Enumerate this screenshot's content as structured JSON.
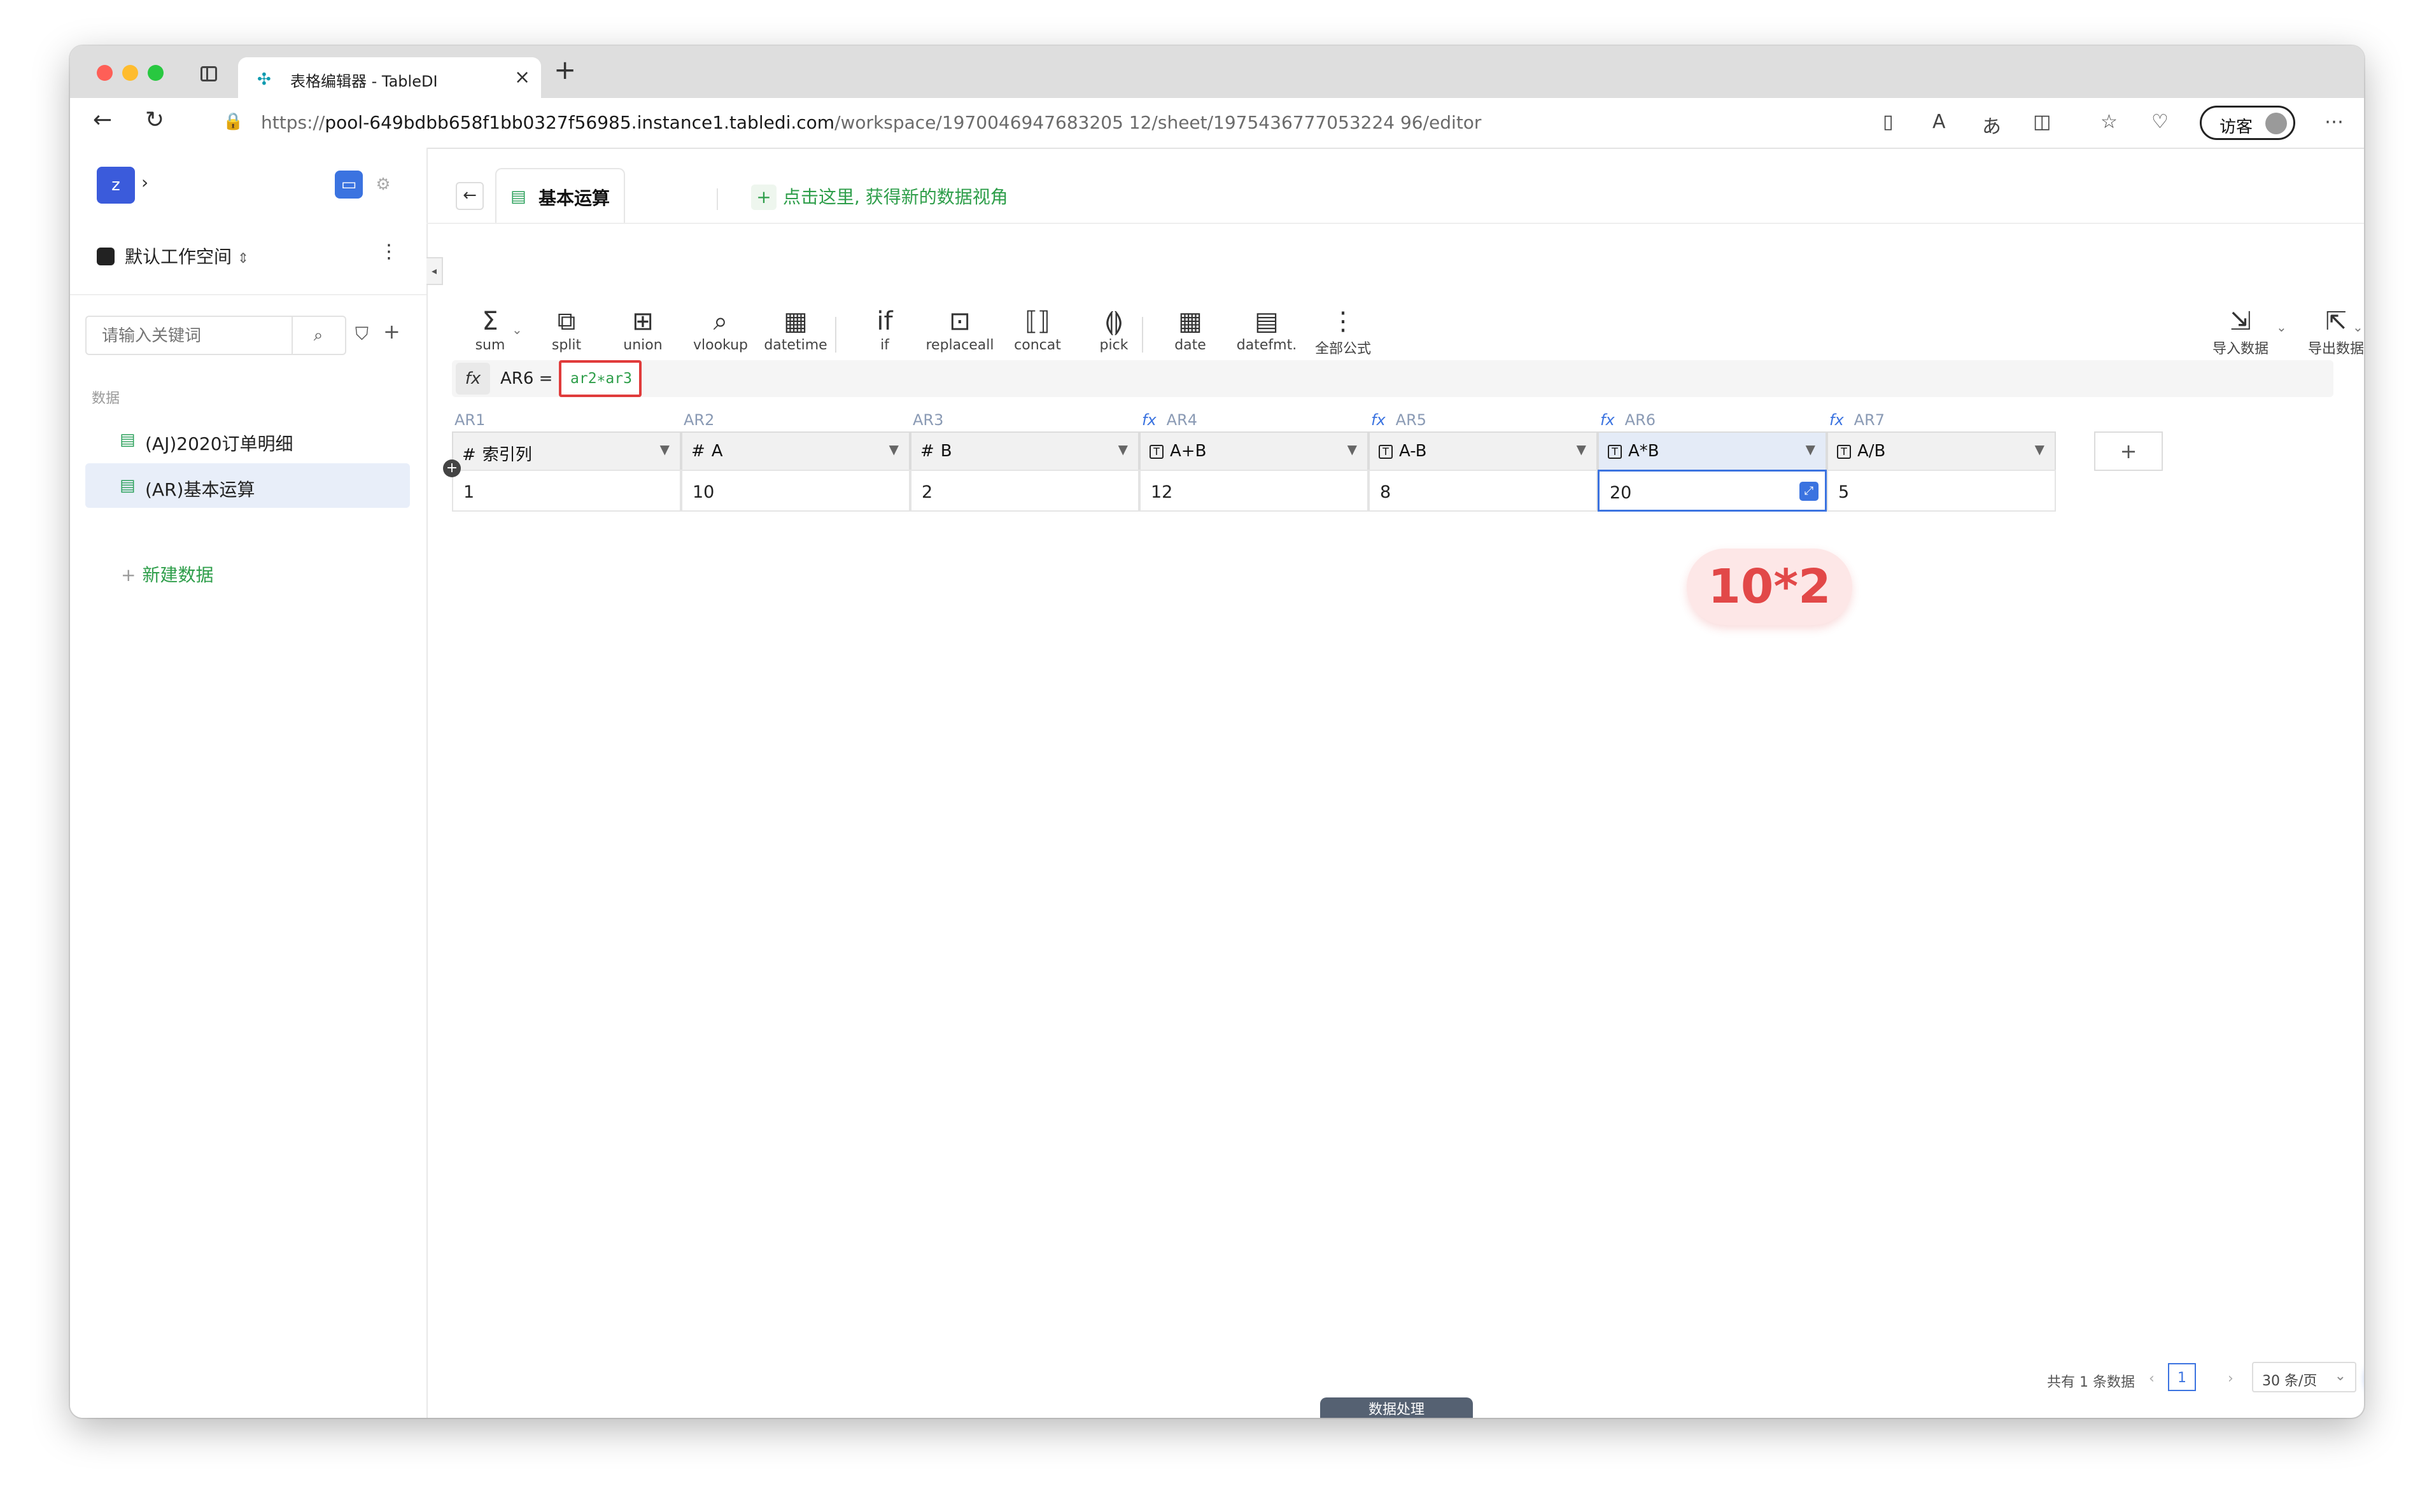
{
  "browser": {
    "tab_title": "表格编辑器 - TableDI",
    "url_prefix": "https://",
    "url_host": "pool-649bdbb658f1bb0327f56985.instance1.tabledi.com",
    "url_path": "/workspace/1970046947683205 12/sheet/1975436777053224 96/editor",
    "visitor_label": "访客"
  },
  "sidebar": {
    "avatar_letter": "z",
    "workspace_name": "默认工作空间",
    "search_placeholder": "请输入关键词",
    "section_label": "数据",
    "items": [
      {
        "label": "(AJ)2020订单明细"
      },
      {
        "label": "(AR)基本运算"
      }
    ],
    "new_data_label": "新建数据"
  },
  "view": {
    "tab_label": "基本运算",
    "add_view_label": "点击这里, 获得新的数据视角"
  },
  "toolbar": {
    "tools": [
      {
        "glyph": "Σ",
        "label": "sum"
      },
      {
        "glyph": "⧉",
        "label": "split"
      },
      {
        "glyph": "⊞",
        "label": "union"
      },
      {
        "glyph": "⌕",
        "label": "vlookup"
      },
      {
        "glyph": "▦",
        "label": "datetime"
      },
      {
        "glyph": "if",
        "label": "if"
      },
      {
        "glyph": "⊡",
        "label": "replaceall"
      },
      {
        "glyph": "⟦⟧",
        "label": "concat"
      },
      {
        "glyph": "⟬⟭",
        "label": "pick"
      },
      {
        "glyph": "▦",
        "label": "date"
      },
      {
        "glyph": "▤",
        "label": "datefmt."
      },
      {
        "glyph": "⋮",
        "label": "全部公式"
      }
    ],
    "import_label": "导入数据",
    "export_label": "导出数据"
  },
  "formula": {
    "fx": "fx",
    "target": "AR6 =",
    "expression": "ar2∗ar3"
  },
  "table": {
    "columns": [
      {
        "id": "AR1",
        "type": "#",
        "name": "索引列",
        "formula": false
      },
      {
        "id": "AR2",
        "type": "#",
        "name": "A",
        "formula": false
      },
      {
        "id": "AR3",
        "type": "#",
        "name": "B",
        "formula": false
      },
      {
        "id": "AR4",
        "type": "T",
        "name": "A+B",
        "formula": true
      },
      {
        "id": "AR5",
        "type": "T",
        "name": "A-B",
        "formula": true
      },
      {
        "id": "AR6",
        "type": "T",
        "name": "A*B",
        "formula": true
      },
      {
        "id": "AR7",
        "type": "T",
        "name": "A/B",
        "formula": true
      }
    ],
    "rows": [
      [
        "1",
        "10",
        "2",
        "12",
        "8",
        "20",
        "5"
      ]
    ],
    "selected_column_index": 5
  },
  "annotation": "10*2",
  "pagination": {
    "total_text": "共有 1 条数据",
    "current_page": "1",
    "per_page": "30 条/页"
  },
  "bottom_panel_label": "数据处理",
  "colors": {
    "accent": "#3b73e0",
    "green": "#2e9e4a",
    "highlight_red": "#e03b3b"
  }
}
